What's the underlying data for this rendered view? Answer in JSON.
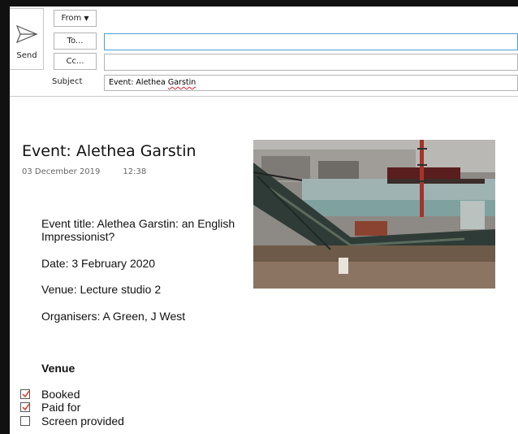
{
  "compose": {
    "send_label": "Send",
    "from_label": "From",
    "from_caret": "▼",
    "to_label": "To...",
    "cc_label": "Cc...",
    "to_value": "",
    "cc_value": "",
    "subject_label": "Subject",
    "subject_prefix": "Event: Alethea ",
    "subject_misspelled": "Garstin"
  },
  "message": {
    "title": "Event: Alethea Garstin",
    "date": "03 December 2019",
    "time": "12:38",
    "event_title_line1": "Event title: Alethea Garstin: an English",
    "event_title_line2": "Impressionist?",
    "date_line": "Date: 3 February 2020",
    "venue_line": "Venue: Lecture studio 2",
    "organisers_line": "Organisers: A Green, J West",
    "venue_heading": "Venue",
    "checklist": [
      {
        "label": "Booked",
        "checked": true
      },
      {
        "label": "Paid for",
        "checked": true
      },
      {
        "label": "Screen provided",
        "checked": false
      }
    ]
  },
  "colors": {
    "accent_blue": "#4a9fd5",
    "check_red": "#d9473a",
    "field_border": "#b4b4b4"
  }
}
